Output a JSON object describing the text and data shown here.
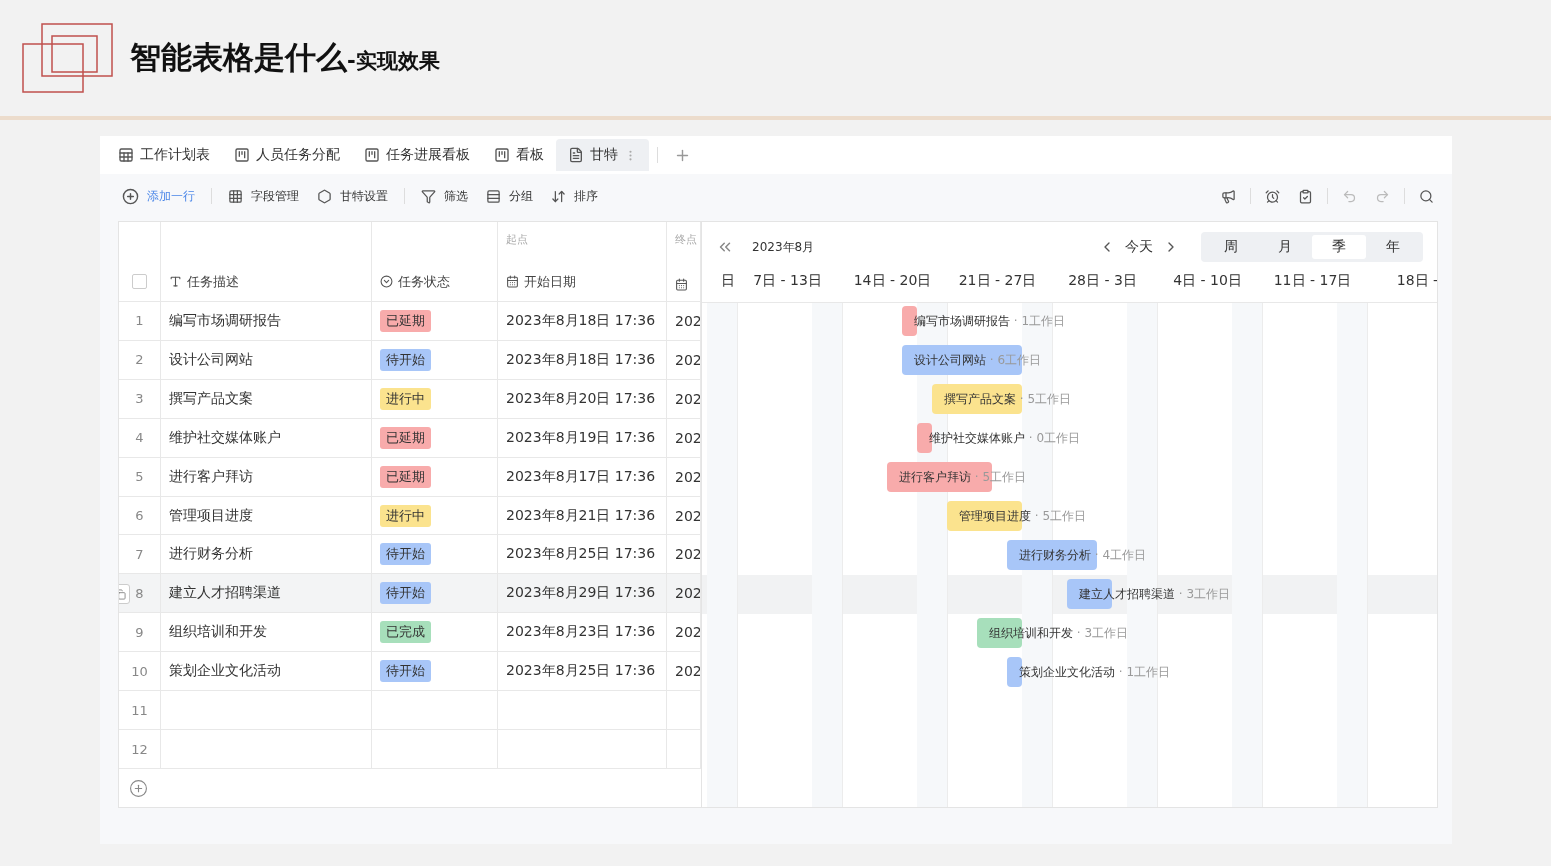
{
  "slide": {
    "title": "智能表格是什么",
    "subtitle": "-实现效果"
  },
  "tabs": [
    {
      "label": "工作计划表",
      "kind": "table",
      "selected": false
    },
    {
      "label": "人员任务分配",
      "kind": "kanban",
      "selected": false
    },
    {
      "label": "任务进展看板",
      "kind": "kanban",
      "selected": false
    },
    {
      "label": "看板",
      "kind": "kanban",
      "selected": false
    },
    {
      "label": "甘特",
      "kind": "gantt",
      "selected": true
    }
  ],
  "toolbar": {
    "items": [
      {
        "label": "添加一行",
        "kind": "add"
      },
      {
        "label": "字段管理",
        "kind": "fields"
      },
      {
        "label": "甘特设置",
        "kind": "settings"
      },
      {
        "label": "筛选",
        "kind": "filter"
      },
      {
        "label": "分组",
        "kind": "group"
      },
      {
        "label": "排序",
        "kind": "sort"
      }
    ]
  },
  "table": {
    "columns": [
      {
        "label": "任务描述",
        "kind": "text"
      },
      {
        "label": "任务状态",
        "kind": "status"
      },
      {
        "label": "开始日期",
        "kind": "date",
        "caption": "起点"
      },
      {
        "kind": "date",
        "caption": "终点"
      }
    ],
    "select_all": {
      "checked": false
    },
    "rows": [
      {
        "number": "1",
        "task": "编写市场调研报告",
        "status": {
          "text": "已延期",
          "kind": "delayed"
        },
        "start": "2023年8月18日 17:36",
        "end": "202",
        "hovered": false
      },
      {
        "number": "2",
        "task": "设计公司网站",
        "status": {
          "text": "待开始",
          "kind": "pending"
        },
        "start": "2023年8月18日 17:36",
        "end": "202",
        "hovered": false
      },
      {
        "number": "3",
        "task": "撰写产品文案",
        "status": {
          "text": "进行中",
          "kind": "progress"
        },
        "start": "2023年8月20日 17:36",
        "end": "202",
        "hovered": false
      },
      {
        "number": "4",
        "task": "维护社交媒体账户",
        "status": {
          "text": "已延期",
          "kind": "delayed"
        },
        "start": "2023年8月19日 17:36",
        "end": "202",
        "hovered": false
      },
      {
        "number": "5",
        "task": "进行客户拜访",
        "status": {
          "text": "已延期",
          "kind": "delayed"
        },
        "start": "2023年8月17日 17:36",
        "end": "202",
        "hovered": false
      },
      {
        "number": "6",
        "task": "管理项目进度",
        "status": {
          "text": "进行中",
          "kind": "progress"
        },
        "start": "2023年8月21日 17:36",
        "end": "202",
        "hovered": false
      },
      {
        "number": "7",
        "task": "进行财务分析",
        "status": {
          "text": "待开始",
          "kind": "pending"
        },
        "start": "2023年8月25日 17:36",
        "end": "202",
        "hovered": false
      },
      {
        "number": "8",
        "task": "建立人才招聘渠道",
        "status": {
          "text": "待开始",
          "kind": "pending"
        },
        "start": "2023年8月29日 17:36",
        "end": "202",
        "hovered": true
      },
      {
        "number": "9",
        "task": "组织培训和开发",
        "status": {
          "text": "已完成",
          "kind": "done"
        },
        "start": "2023年8月23日 17:36",
        "end": "202",
        "hovered": false
      },
      {
        "number": "10",
        "task": "策划企业文化活动",
        "status": {
          "text": "待开始",
          "kind": "pending"
        },
        "start": "2023年8月25日 17:36",
        "end": "202",
        "hovered": false
      },
      {
        "number": "11",
        "task": "",
        "hovered": false
      },
      {
        "number": "12",
        "task": "",
        "hovered": false
      }
    ]
  },
  "gantt": {
    "month": "2023年8月",
    "today": "今天",
    "scales": [
      {
        "label": "周",
        "selected": false
      },
      {
        "label": "月",
        "selected": false
      },
      {
        "label": "季",
        "selected": true
      },
      {
        "label": "年",
        "selected": false
      }
    ],
    "weeks": [
      "日",
      "7日 - 13日",
      "14日 - 20日",
      "21日 - 27日",
      "28日 - 3日",
      "4日 - 10日",
      "11日 - 17日",
      "18日 -"
    ],
    "bars": [
      {
        "label": "编写市场调研报告",
        "duration": "· 1工作日",
        "kind": "delayed"
      },
      {
        "label": "设计公司网站",
        "duration": "· 6工作日",
        "kind": "pending"
      },
      {
        "label": "撰写产品文案",
        "duration": "· 5工作日",
        "kind": "progress"
      },
      {
        "label": "维护社交媒体账户",
        "duration": "· 0工作日",
        "kind": "delayed"
      },
      {
        "label": "进行客户拜访",
        "duration": "· 5工作日",
        "kind": "delayed"
      },
      {
        "label": "管理项目进度",
        "duration": "· 5工作日",
        "kind": "progress"
      },
      {
        "label": "进行财务分析",
        "duration": "· 4工作日",
        "kind": "pending"
      },
      {
        "label": "建立人才招聘渠道",
        "duration": "· 3工作日",
        "kind": "pending"
      },
      {
        "label": "组织培训和开发",
        "duration": "· 3工作日",
        "kind": "done"
      },
      {
        "label": "策划企业文化活动",
        "duration": "· 1工作日",
        "kind": "pending"
      }
    ]
  }
}
